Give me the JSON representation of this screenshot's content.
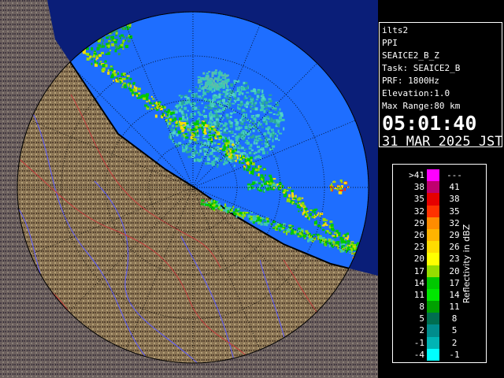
{
  "info": {
    "site": "ilts2",
    "product": "PPI",
    "scan": "SEAICE2_B_Z",
    "task": "Task: SEAICE2_B",
    "prf": "PRF: 1800Hz",
    "elevation": "Elevation:1.0",
    "max_range": "Max Range:80 km",
    "time": "05:01:40",
    "date": "31 MAR 2025 JST"
  },
  "legend": {
    "title": "Reflectivity in dBZ",
    "rows": [
      {
        "lo": ">41",
        "hi": "---",
        "color": "#ff00ff"
      },
      {
        "lo": "38",
        "hi": "41",
        "color": "#c0006e"
      },
      {
        "lo": "35",
        "hi": "38",
        "color": "#e60000"
      },
      {
        "lo": "32",
        "hi": "35",
        "color": "#ff3200"
      },
      {
        "lo": "29",
        "hi": "32",
        "color": "#ff8c00"
      },
      {
        "lo": "26",
        "hi": "29",
        "color": "#ffb400"
      },
      {
        "lo": "23",
        "hi": "26",
        "color": "#ffdc00"
      },
      {
        "lo": "20",
        "hi": "23",
        "color": "#ffff00"
      },
      {
        "lo": "17",
        "hi": "20",
        "color": "#96dc00"
      },
      {
        "lo": "14",
        "hi": "17",
        "color": "#00c800"
      },
      {
        "lo": "11",
        "hi": "14",
        "color": "#00e600"
      },
      {
        "lo": "8",
        "hi": "11",
        "color": "#00a000"
      },
      {
        "lo": "5",
        "hi": "8",
        "color": "#006e50"
      },
      {
        "lo": "2",
        "hi": "5",
        "color": "#008c8c"
      },
      {
        "lo": "-1",
        "hi": "2",
        "color": "#00b4b4"
      },
      {
        "lo": "-4",
        "hi": "-1",
        "color": "#00ffff"
      }
    ]
  },
  "map": {
    "sea_color": "#1e6eff",
    "land_color": "#8c7655",
    "out_of_range_color": "#0a1e78",
    "coastline_color": "#000000",
    "river_color": "#5a5aff",
    "boundary_color": "#c83c3c",
    "echo_colors": [
      "#3cc8b4",
      "#00c800",
      "#96dc00",
      "#ffdc00"
    ]
  }
}
